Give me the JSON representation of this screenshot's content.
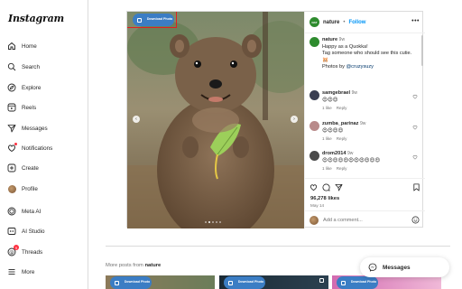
{
  "app": {
    "logo": "Instagram"
  },
  "sidebar": {
    "items": [
      {
        "label": "Home",
        "icon": "home-icon"
      },
      {
        "label": "Search",
        "icon": "search-icon"
      },
      {
        "label": "Explore",
        "icon": "compass-icon"
      },
      {
        "label": "Reels",
        "icon": "reels-icon"
      },
      {
        "label": "Messages",
        "icon": "send-icon"
      },
      {
        "label": "Notifications",
        "icon": "heart-icon"
      },
      {
        "label": "Create",
        "icon": "plus-square-icon"
      },
      {
        "label": "Profile",
        "icon": "avatar-icon"
      },
      {
        "label": "Meta AI",
        "icon": "meta-ai-icon"
      },
      {
        "label": "AI Studio",
        "icon": "ai-studio-icon"
      },
      {
        "label": "Threads",
        "icon": "threads-icon",
        "badge": "9"
      },
      {
        "label": "More",
        "icon": "menu-icon"
      }
    ]
  },
  "post": {
    "download_button": "Download Photo",
    "author": "nature",
    "separator": "•",
    "follow_label": "Follow",
    "more": "•••",
    "caption": {
      "user": "nature",
      "time": "9w",
      "lines": [
        "Happy as a Quokka!",
        "Tag someone who should see this cutie.",
        "🐹"
      ],
      "credit_prefix": "Photos by ",
      "credit_handle": "@cruzysuzy"
    },
    "comments": [
      {
        "user": "samgebrael",
        "time": "9w",
        "text": "😍😍😍",
        "likes": "1 like",
        "reply": "Reply"
      },
      {
        "user": "zumba_parinaz",
        "time": "9w",
        "text": "😍😍😍😍",
        "likes": "1 like",
        "reply": "Reply"
      },
      {
        "user": "drom2014",
        "time": "9w",
        "text": "😍😍😍😍😍😍😍😍😍😍😍",
        "likes": "1 like",
        "reply": "Reply"
      }
    ],
    "likes": "96,278 likes",
    "date": "May 14",
    "comment_placeholder": "Add a comment..."
  },
  "more_posts": {
    "prefix": "More posts from ",
    "author": "nature",
    "download_button": "Download Photo"
  },
  "messages_fab": {
    "label": "Messages"
  },
  "colors": {
    "accent": "#0095f6",
    "download_btn": "#3b7dc4",
    "highlight": "#e02020",
    "notif": "#ff3040"
  }
}
